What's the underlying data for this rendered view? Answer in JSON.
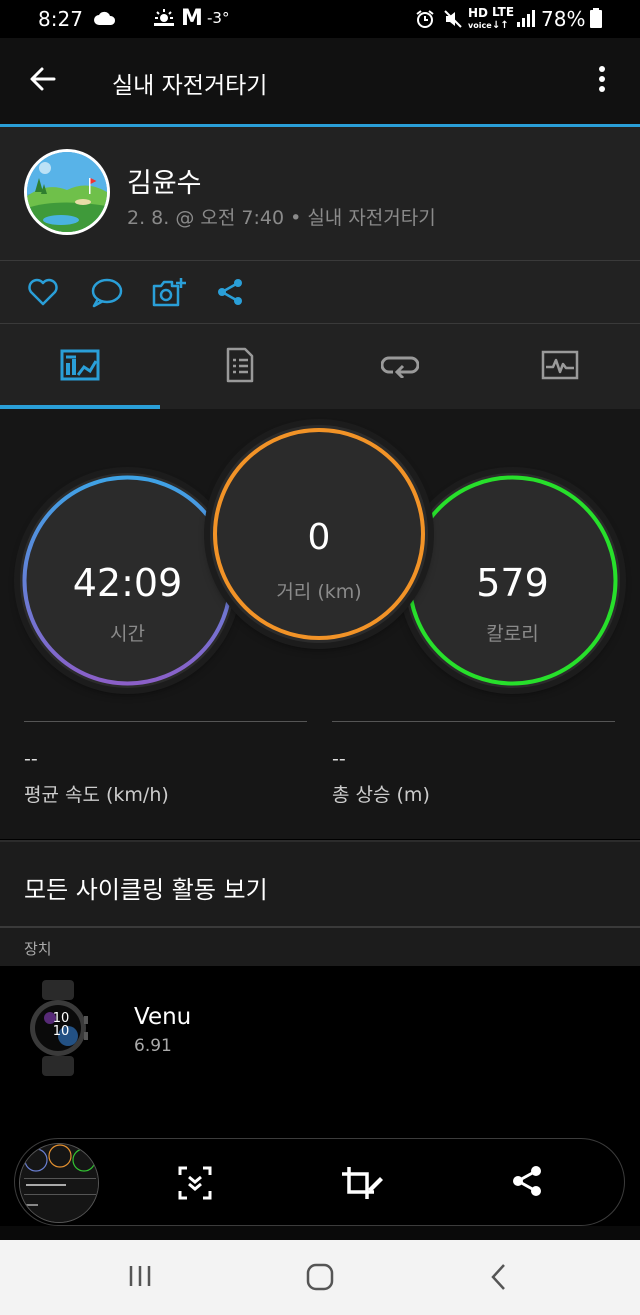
{
  "status_bar": {
    "time": "8:27",
    "temperature": "-3°",
    "battery_percent": "78%",
    "weather_icon": "sun-cloud-icon",
    "mail_icon": "gmail-m-icon",
    "hd_label": "HD",
    "lte_label": "LTE"
  },
  "app_bar": {
    "title": "실내 자전거타기"
  },
  "profile": {
    "name": "김윤수",
    "meta": "2. 8. @ 오전 7:40 • 실내 자전거타기"
  },
  "tabs": [
    {
      "icon": "chart-icon",
      "active": true
    },
    {
      "icon": "document-icon",
      "active": false
    },
    {
      "icon": "laps-loop-icon",
      "active": false
    },
    {
      "icon": "heartrate-graph-icon",
      "active": false
    }
  ],
  "metrics": {
    "time": {
      "value": "42:09",
      "label": "시간"
    },
    "distance": {
      "value": "0",
      "label": "거리 (km)"
    },
    "calories": {
      "value": "579",
      "label": "칼로리"
    }
  },
  "stats": {
    "avg_speed": {
      "value": "--",
      "label": "평균 속도 (km/h)"
    },
    "total_ascent": {
      "value": "--",
      "label": "총 상승 (m)"
    }
  },
  "all_cycling": {
    "label": "모든 사이클링 활동 보기"
  },
  "device_section": {
    "header": "장치",
    "name": "Venu",
    "version": "6.91",
    "watch_time": "10\n10"
  },
  "colors": {
    "accent_blue": "#2a9fd8",
    "ring_time_start": "#3ea3e6",
    "ring_time_end": "#8b5fc8",
    "ring_distance": "#f29327",
    "ring_calories": "#27e02b"
  }
}
